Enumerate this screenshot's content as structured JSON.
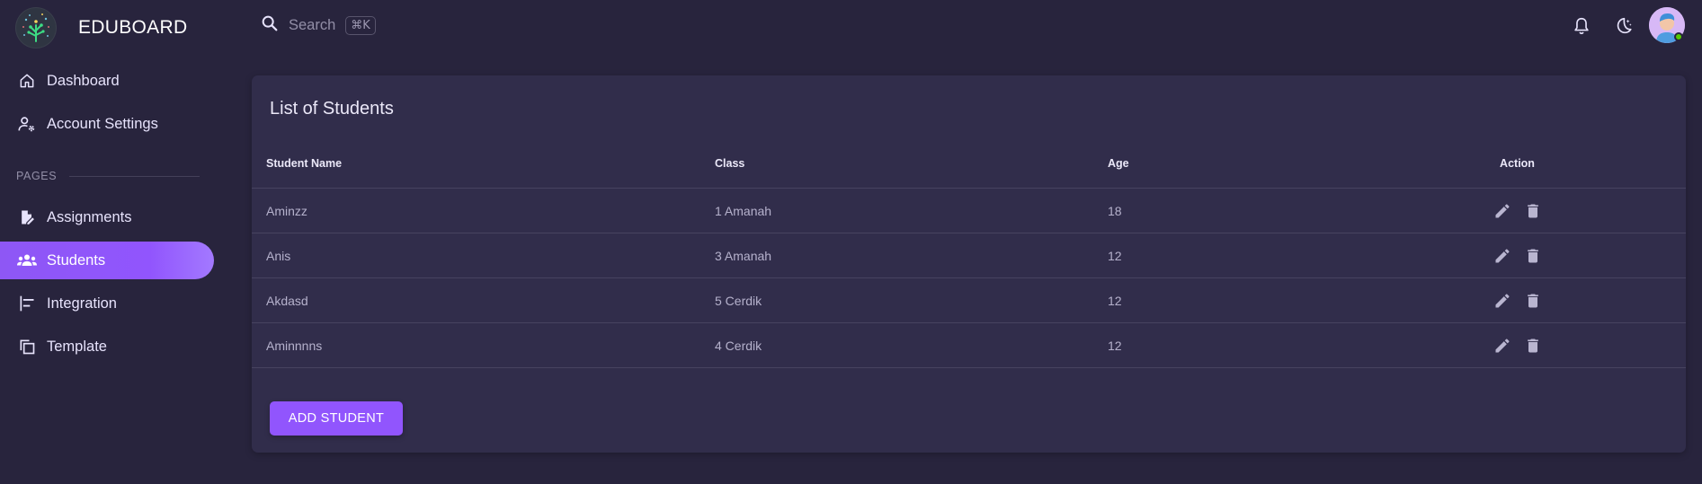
{
  "brand": {
    "name": "EDUBOARD",
    "logo_icon": "tree-circuit-logo"
  },
  "search": {
    "placeholder": "Search",
    "shortcut": "⌘K"
  },
  "sidebar": {
    "items": [
      {
        "label": "Dashboard",
        "icon": "home-icon"
      },
      {
        "label": "Account Settings",
        "icon": "account-cog-icon"
      }
    ],
    "section": "PAGES",
    "pages": [
      {
        "label": "Assignments",
        "icon": "file-edit-icon"
      },
      {
        "label": "Students",
        "icon": "account-group-icon",
        "active": true
      },
      {
        "label": "Integration",
        "icon": "align-left-icon"
      },
      {
        "label": "Template",
        "icon": "copy-icon"
      }
    ]
  },
  "topbar": {
    "icons": [
      "bell-icon",
      "moon-icon",
      "avatar"
    ]
  },
  "card": {
    "title": "List of Students",
    "columns": [
      "Student Name",
      "Class",
      "Age",
      "Action"
    ],
    "rows": [
      {
        "name": "Aminzz",
        "class": "1 Amanah",
        "age": "18"
      },
      {
        "name": "Anis",
        "class": "3 Amanah",
        "age": "12"
      },
      {
        "name": "Akdasd",
        "class": "5 Cerdik",
        "age": "12"
      },
      {
        "name": "Aminnnns",
        "class": "4 Cerdik",
        "age": "12"
      }
    ],
    "add_button": "ADD STUDENT"
  },
  "colors": {
    "background": "#28243d",
    "card": "#312d4b",
    "accent": "#9155fd",
    "online": "#56ca00"
  }
}
